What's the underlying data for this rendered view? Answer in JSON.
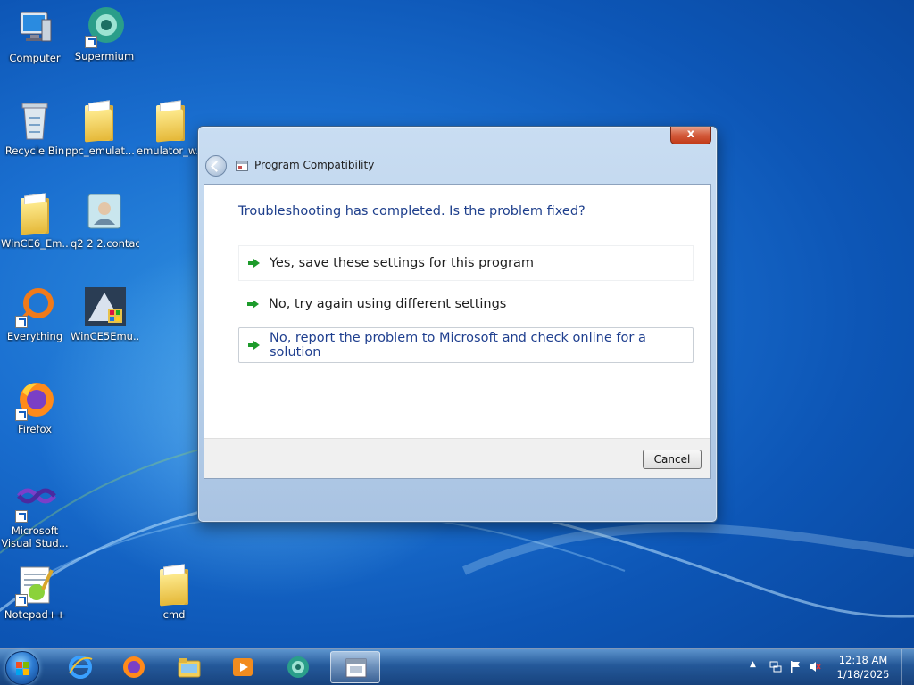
{
  "desktop": {
    "icons": [
      {
        "label": "Computer"
      },
      {
        "label": "Supermium"
      },
      {
        "label": "Recycle Bin"
      },
      {
        "label": "ppc_emulat..."
      },
      {
        "label": "emulator_w..."
      },
      {
        "label": "WinCE6_Em..."
      },
      {
        "label": "q2 2 2.contact"
      },
      {
        "label": "Everything"
      },
      {
        "label": "WinCE5Emu..."
      },
      {
        "label": "Firefox"
      },
      {
        "label": "Microsoft Visual Stud..."
      },
      {
        "label": "Notepad++"
      },
      {
        "label": "cmd"
      }
    ]
  },
  "dialog": {
    "title": "Program Compatibility",
    "close_glyph": "x",
    "question": "Troubleshooting has completed.  Is the problem fixed?",
    "options": [
      {
        "label": "Yes, save these settings for this program"
      },
      {
        "label": "No, try again using different settings"
      },
      {
        "label": "No, report the problem to Microsoft and check online for a solution"
      }
    ],
    "cancel_label": "Cancel"
  },
  "taskbar": {
    "pinned": [
      "internet-explorer-icon",
      "firefox-icon",
      "file-explorer-icon",
      "media-player-icon",
      "supermium-icon",
      "program-compatibility-icon"
    ],
    "clock": {
      "time": "12:18 AM",
      "date": "1/18/2025"
    },
    "tray_glyph": "▲"
  }
}
